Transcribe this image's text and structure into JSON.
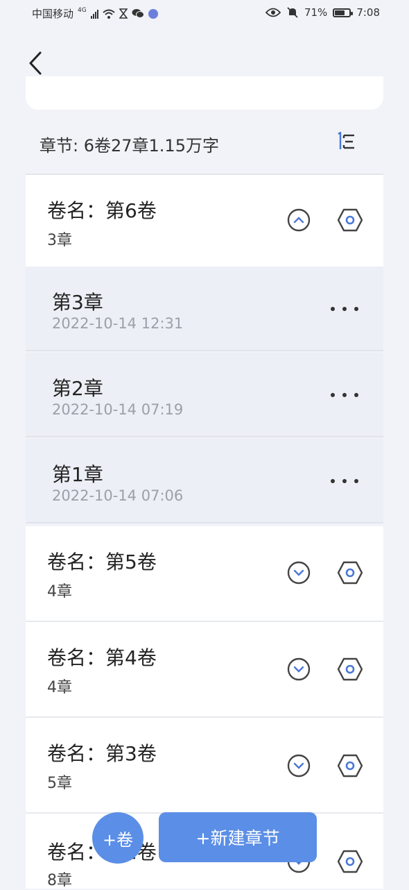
{
  "status_bar": {
    "carrier": "中国移动",
    "network": "4G",
    "battery_text": "71%",
    "battery_level": 0.71,
    "time": "7:08"
  },
  "summary": {
    "text": "章节: 6卷27章1.15万字"
  },
  "volumes": [
    {
      "title": "卷名：第6卷",
      "count": "3章",
      "expanded": true
    },
    {
      "title": "卷名：第5卷",
      "count": "4章",
      "expanded": false
    },
    {
      "title": "卷名：第4卷",
      "count": "4章",
      "expanded": false
    },
    {
      "title": "卷名：第3卷",
      "count": "5章",
      "expanded": false
    },
    {
      "title": "卷名：第2卷",
      "count": "8章",
      "expanded": false
    }
  ],
  "chapters": [
    {
      "title": "第3章",
      "date": "2022-10-14 12:31"
    },
    {
      "title": "第2章",
      "date": "2022-10-14 07:19"
    },
    {
      "title": "第1章",
      "date": "2022-10-14 07:06"
    }
  ],
  "actions": {
    "add_volume": "+卷",
    "new_chapter": "+新建章节"
  },
  "colors": {
    "accent": "#5b8ee6",
    "background": "#f1f3f8",
    "chapter_bg": "#eceff5"
  }
}
